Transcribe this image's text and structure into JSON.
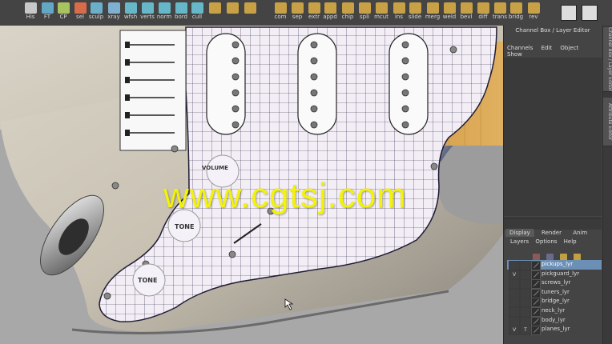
{
  "shelf": {
    "tools": [
      {
        "id": "his",
        "label": "His",
        "color": "#c8c8c8"
      },
      {
        "id": "ft",
        "label": "FT",
        "color": "#62a8c4"
      },
      {
        "id": "cp",
        "label": "CP",
        "color": "#a8c45e"
      },
      {
        "id": "sel",
        "label": "sel",
        "color": "#d86b4a"
      },
      {
        "id": "sculp",
        "label": "sculp",
        "color": "#6bb0c8"
      },
      {
        "id": "xray",
        "label": "xray",
        "color": "#7fb0d0"
      },
      {
        "id": "wfsh",
        "label": "wfsh",
        "color": "#66b8c8"
      },
      {
        "id": "verts",
        "label": "verts",
        "color": "#66b8c8"
      },
      {
        "id": "norm",
        "label": "norm",
        "color": "#66b8c8"
      },
      {
        "id": "bord",
        "label": "bord",
        "color": "#66b8c8"
      },
      {
        "id": "cull",
        "label": "cull",
        "color": "#66b8c8"
      },
      {
        "id": "t1",
        "label": "",
        "color": "#c8a046"
      },
      {
        "id": "t2",
        "label": "",
        "color": "#c8a046"
      },
      {
        "id": "t3",
        "label": "",
        "color": "#c8a046"
      },
      {
        "id": "com",
        "label": "com",
        "color": "#c8a046"
      },
      {
        "id": "sep",
        "label": "sep",
        "color": "#c8a046"
      },
      {
        "id": "extr",
        "label": "extr",
        "color": "#c8a046"
      },
      {
        "id": "appd",
        "label": "appd",
        "color": "#c8a046"
      },
      {
        "id": "chip",
        "label": "chip",
        "color": "#c8a046"
      },
      {
        "id": "spli",
        "label": "spli",
        "color": "#c8a046"
      },
      {
        "id": "mcut",
        "label": "mcut",
        "color": "#c8a046"
      },
      {
        "id": "ins",
        "label": "ins",
        "color": "#c8a046"
      },
      {
        "id": "slide",
        "label": "slide",
        "color": "#c8a046"
      },
      {
        "id": "merg",
        "label": "merg",
        "color": "#c8a046"
      },
      {
        "id": "weld",
        "label": "weld",
        "color": "#c8a046"
      },
      {
        "id": "bevl",
        "label": "bevl",
        "color": "#c8a046"
      },
      {
        "id": "diff",
        "label": "diff",
        "color": "#c8a046"
      },
      {
        "id": "trans",
        "label": "trans",
        "color": "#c8a046"
      },
      {
        "id": "bridg",
        "label": "bridg",
        "color": "#c8a046"
      },
      {
        "id": "rev",
        "label": "rev",
        "color": "#c8a046"
      }
    ]
  },
  "viewport": {
    "watermark": "www.cgtsj.com",
    "tone_label_1": "TONE",
    "tone_label_2": "TONE",
    "volume_label": "VOLUME"
  },
  "channel_box": {
    "title": "Channel Box / Layer Editor",
    "menu": [
      "Channels",
      "Edit",
      "Object",
      "Show"
    ]
  },
  "side_tabs": [
    "Channel Box / Layer Editor",
    "Attribute Editor"
  ],
  "layer_editor": {
    "tabs": [
      "Display",
      "Render",
      "Anim"
    ],
    "active_tab": "Display",
    "menu": [
      "Layers",
      "Options",
      "Help"
    ],
    "layers": [
      {
        "name": "pickups_lyr",
        "v": "",
        "t": "",
        "selected": true
      },
      {
        "name": "pickguard_lyr",
        "v": "V",
        "t": "",
        "selected": false
      },
      {
        "name": "screws_lyr",
        "v": "",
        "t": "",
        "selected": false
      },
      {
        "name": "tuners_lyr",
        "v": "",
        "t": "",
        "selected": false
      },
      {
        "name": "bridge_lyr",
        "v": "",
        "t": "",
        "selected": false
      },
      {
        "name": "neck_lyr",
        "v": "",
        "t": "",
        "selected": false
      },
      {
        "name": "body_lyr",
        "v": "",
        "t": "",
        "selected": false
      },
      {
        "name": "planes_lyr",
        "v": "V",
        "t": "T",
        "selected": false
      }
    ]
  }
}
